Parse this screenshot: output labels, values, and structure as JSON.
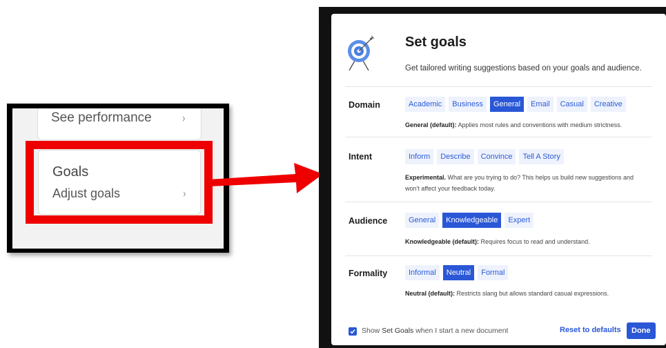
{
  "left_panel": {
    "performance_label": "See performance",
    "goals_title": "Goals",
    "goals_subtitle": "Adjust goals",
    "chevron": "›"
  },
  "modal": {
    "title": "Set goals",
    "subtitle": "Get tailored writing suggestions based on your goals and audience.",
    "sections": {
      "domain": {
        "label": "Domain",
        "options": [
          "Academic",
          "Business",
          "General",
          "Email",
          "Casual",
          "Creative"
        ],
        "selected": "General",
        "desc_bold": "General (default):",
        "desc_text": " Applies most rules and conventions with medium strictness."
      },
      "intent": {
        "label": "Intent",
        "options": [
          "Inform",
          "Describe",
          "Convince",
          "Tell A Story"
        ],
        "selected": "",
        "desc_bold": "Experimental.",
        "desc_text": " What are you trying to do? This helps us build new suggestions and won't affect your feedback today."
      },
      "audience": {
        "label": "Audience",
        "options": [
          "General",
          "Knowledgeable",
          "Expert"
        ],
        "selected": "Knowledgeable",
        "desc_bold": "Knowledgeable (default):",
        "desc_text": " Requires focus to read and understand."
      },
      "formality": {
        "label": "Formality",
        "options": [
          "Informal",
          "Neutral",
          "Formal"
        ],
        "selected": "Neutral",
        "desc_bold": "Neutral (default):",
        "desc_text": " Restricts slang but allows standard casual expressions."
      }
    },
    "footer": {
      "checkbox_checked": true,
      "show_prefix": "Show ",
      "show_bold": "Set Goals",
      "show_suffix": " when I start a new document",
      "reset_label": "Reset to defaults",
      "done_label": "Done"
    }
  },
  "colors": {
    "accent": "#2957d6",
    "chip_bg": "#eef2fd",
    "highlight_red": "#ee0000"
  },
  "icons": [
    "target-icon",
    "chevron-right-icon",
    "checkmark-icon",
    "red-arrow-icon"
  ]
}
